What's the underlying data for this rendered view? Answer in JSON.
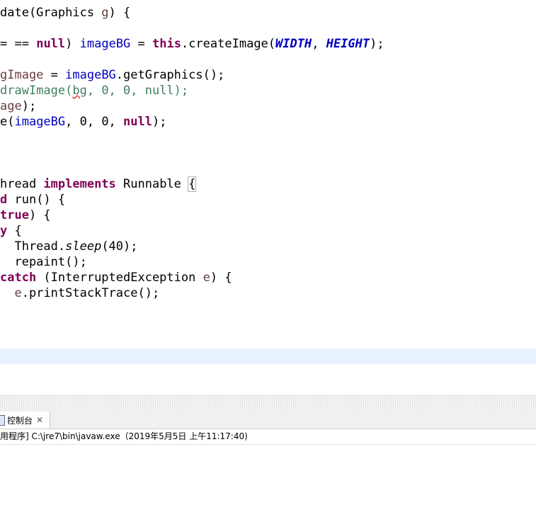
{
  "editor": {
    "lines": [
      [
        [
          "",
          "date(Graphics "
        ],
        [
          "var",
          "g"
        ],
        [
          "",
          ") {"
        ]
      ],
      [],
      [
        [
          "",
          "= "
        ],
        [
          "",
          "== "
        ],
        [
          "kw",
          "null"
        ],
        [
          "",
          ") "
        ],
        [
          "fld",
          "imageBG"
        ],
        [
          "",
          " = "
        ],
        [
          "kw",
          "this"
        ],
        [
          "",
          ".createImage("
        ],
        [
          "cst",
          "WIDTH"
        ],
        [
          "",
          ", "
        ],
        [
          "cst",
          "HEIGHT"
        ],
        [
          "",
          ");"
        ]
      ],
      [],
      [
        [
          "var",
          "gImage"
        ],
        [
          "",
          " = "
        ],
        [
          "fld",
          "imageBG"
        ],
        [
          "",
          ".getGraphics();"
        ]
      ],
      [
        [
          "cmt",
          "drawImage("
        ],
        [
          "cmt sq",
          "bg"
        ],
        [
          "cmt",
          ", 0, 0, null);"
        ]
      ],
      [
        [
          "var",
          "age"
        ],
        [
          "",
          ");"
        ]
      ],
      [
        [
          "",
          "e("
        ],
        [
          "fld",
          "imageBG"
        ],
        [
          "",
          ", 0, 0, "
        ],
        [
          "kw",
          "null"
        ],
        [
          "",
          ");"
        ]
      ],
      [],
      [],
      [],
      [
        [
          "",
          "hread "
        ],
        [
          "kw",
          "implements"
        ],
        [
          "",
          " Runnable "
        ],
        [
          "bracket-box",
          "{"
        ]
      ],
      [
        [
          "kw",
          "d"
        ],
        [
          "",
          " run() {"
        ]
      ],
      [
        [
          "kw",
          "true"
        ],
        [
          "",
          ") {"
        ]
      ],
      [
        [
          "kw",
          "y"
        ],
        [
          "",
          " {"
        ]
      ],
      [
        [
          "",
          "  Thread."
        ],
        [
          "ital",
          "sleep"
        ],
        [
          "",
          "(40);"
        ]
      ],
      [
        [
          "",
          "  repaint();"
        ]
      ],
      [
        [
          "kw",
          "catch"
        ],
        [
          "",
          " (InterruptedException "
        ],
        [
          "var",
          "e"
        ],
        [
          "",
          ") {"
        ]
      ],
      [
        [
          "",
          "  "
        ],
        [
          "var",
          "e"
        ],
        [
          "",
          ".printStackTrace();"
        ]
      ]
    ]
  },
  "console": {
    "tab_label": "控制台",
    "tab_close": "✕",
    "tab_icon": "console-icon",
    "status": "用程序] C:\\jre7\\bin\\javaw.exe（2019年5月5日 上午11:17:40)"
  },
  "colors": {
    "keyword": "#7f0055",
    "field": "#0000c0",
    "local_variable": "#6a3e3e",
    "comment": "#3f7f5f",
    "current_line": "#e8f2fe"
  }
}
